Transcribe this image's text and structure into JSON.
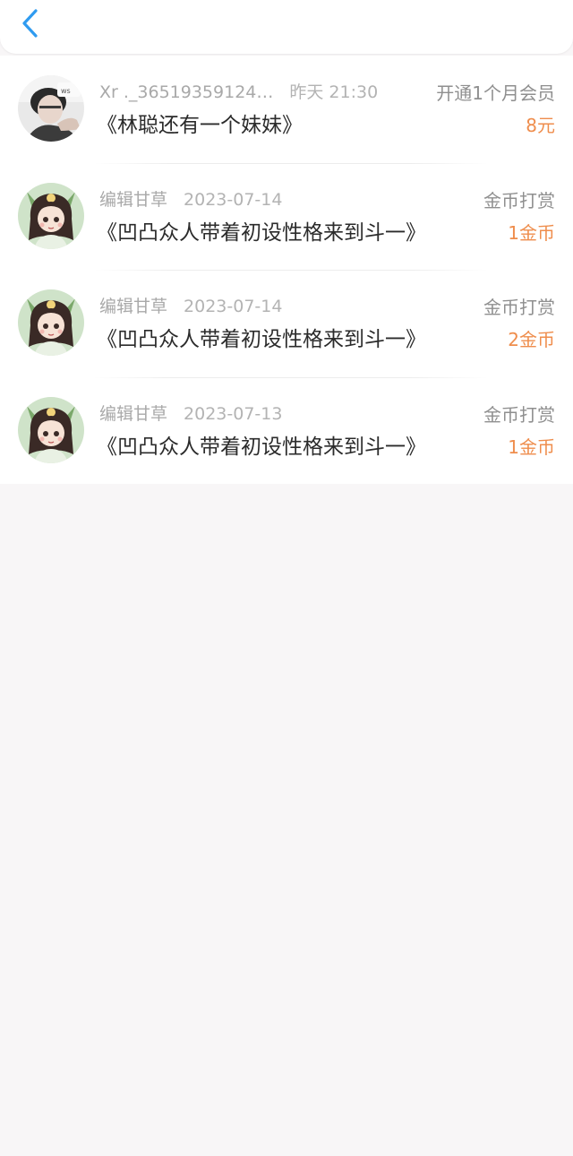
{
  "header": {
    "back_icon": "chevron-left-icon",
    "accent_color": "#2f9bf0"
  },
  "records": [
    {
      "user": "Xr ._36519359124…",
      "date": "昨天 21:30",
      "book": "《林聪还有一个妹妹》",
      "type": "开通1个月会员",
      "amount": "8元",
      "avatar": "user-photo-avatar"
    },
    {
      "user": "编辑甘草",
      "date": "2023-07-14",
      "book": "《凹凸众人带着初设性格来到斗一》",
      "type": "金币打赏",
      "amount": "1金币",
      "avatar": "anime-girl-avatar"
    },
    {
      "user": "编辑甘草",
      "date": "2023-07-14",
      "book": "《凹凸众人带着初设性格来到斗一》",
      "type": "金币打赏",
      "amount": "2金币",
      "avatar": "anime-girl-avatar"
    },
    {
      "user": "编辑甘草",
      "date": "2023-07-13",
      "book": "《凹凸众人带着初设性格来到斗一》",
      "type": "金币打赏",
      "amount": "1金币",
      "avatar": "anime-girl-avatar"
    }
  ],
  "colors": {
    "amount": "#ef8d4c",
    "page_bg": "#f8f6f7"
  }
}
